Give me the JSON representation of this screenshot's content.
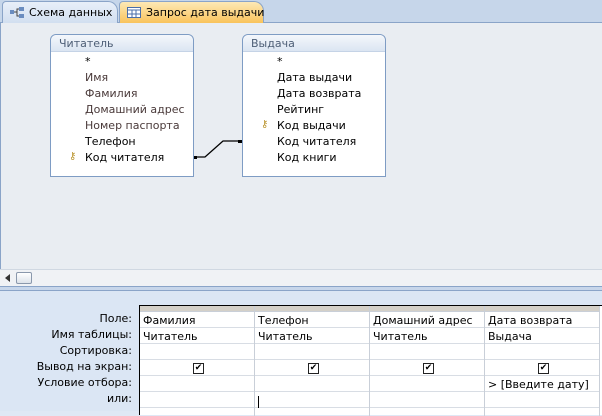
{
  "tabs": [
    {
      "label": "Схема данных",
      "icon": "relationships-icon"
    },
    {
      "label": "Запрос дата выдачи",
      "icon": "query-icon",
      "active": true
    }
  ],
  "tables": [
    {
      "title": "Читатель",
      "fields": [
        "*",
        "Имя",
        "Фамилия",
        "Домашний адрес",
        "Номер паспорта",
        "Телефон",
        "Код читателя"
      ],
      "key_field": "Код читателя"
    },
    {
      "title": "Выдача",
      "fields": [
        "*",
        "Дата выдачи",
        "Дата возврата",
        "Рейтинг",
        "Код выдачи",
        "Код читателя",
        "Код книги"
      ],
      "key_field": "Код выдачи"
    }
  ],
  "grid": {
    "row_labels": [
      "Поле:",
      "Имя таблицы:",
      "Сортировка:",
      "Вывод на экран:",
      "Условие отбора:",
      "или:"
    ],
    "columns": [
      {
        "field": "Фамилия",
        "table": "Читатель",
        "sort": "",
        "show": true,
        "criteria": ""
      },
      {
        "field": "Телефон",
        "table": "Читатель",
        "sort": "",
        "show": true,
        "criteria": ""
      },
      {
        "field": "Домашний адрес",
        "table": "Читатель",
        "sort": "",
        "show": true,
        "criteria": ""
      },
      {
        "field": "Дата возврата",
        "table": "Выдача",
        "sort": "",
        "show": true,
        "criteria": "> [Введите дату]"
      }
    ]
  }
}
